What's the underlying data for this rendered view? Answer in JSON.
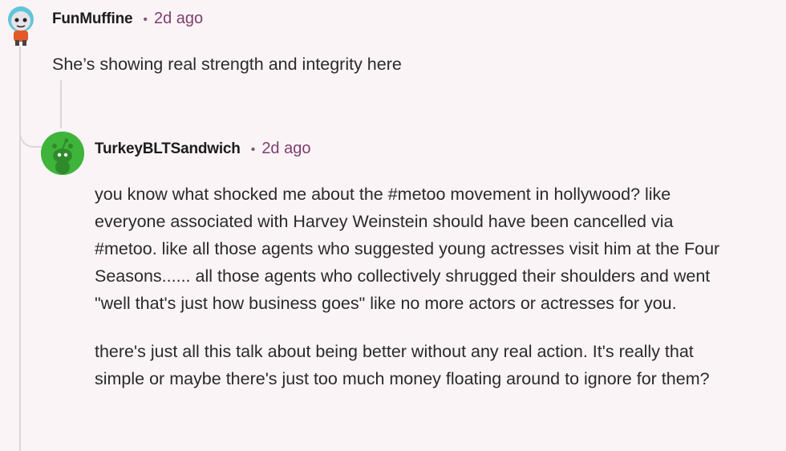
{
  "comments": [
    {
      "username": "FunMuffine",
      "separator": "•",
      "timestamp": "2d ago",
      "avatar_icon": "snoo-avatar-icon",
      "body": [
        "She’s showing real strength and integrity here"
      ]
    },
    {
      "username": "TurkeyBLTSandwich",
      "separator": "•",
      "timestamp": "2d ago",
      "avatar_icon": "snoo-avatar-icon",
      "avatar_color": "#3fb43b",
      "body": [
        "you know what shocked me about the #metoo movement in hollywood? like everyone associated with Harvey Weinstein should have been cancelled via #metoo. like all those agents who suggested young actresses visit him at the Four Seasons...... all those agents who collectively shrugged their shoulders and went \"well that's just how business goes\" like no more actors or actresses for you.",
        "there's just all this talk about being better without any real action. It's really that simple or maybe there's just too much money floating around to ignore for them?"
      ]
    }
  ]
}
